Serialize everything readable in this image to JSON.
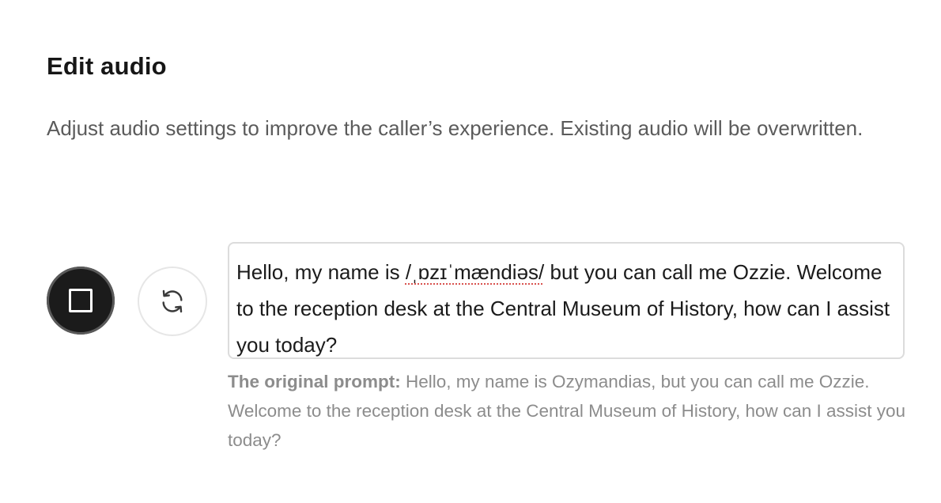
{
  "dialog": {
    "title": "Edit audio",
    "description": "Adjust audio settings to improve the caller’s experience. Existing audio will be overwritten."
  },
  "controls": {
    "stop_icon": "stop-square-icon",
    "regenerate_icon": "refresh-icon"
  },
  "prompt": {
    "before": "Hello, my name is ",
    "phonetic": "/ˌɒzɪˈmændiəs/",
    "after": " but you can call me Ozzie. Welcome to the reception desk at the Central Museum of History, how can I assist you today?"
  },
  "original": {
    "label": "The original prompt:",
    "text": " Hello, my name is Ozymandias, but you can call me Ozzie. Welcome to the reception desk at the Central Museum of History, how can I assist you today?"
  },
  "colors": {
    "stop_button": "#1b1b1b",
    "spellcheck_underline": "#d9534f"
  }
}
